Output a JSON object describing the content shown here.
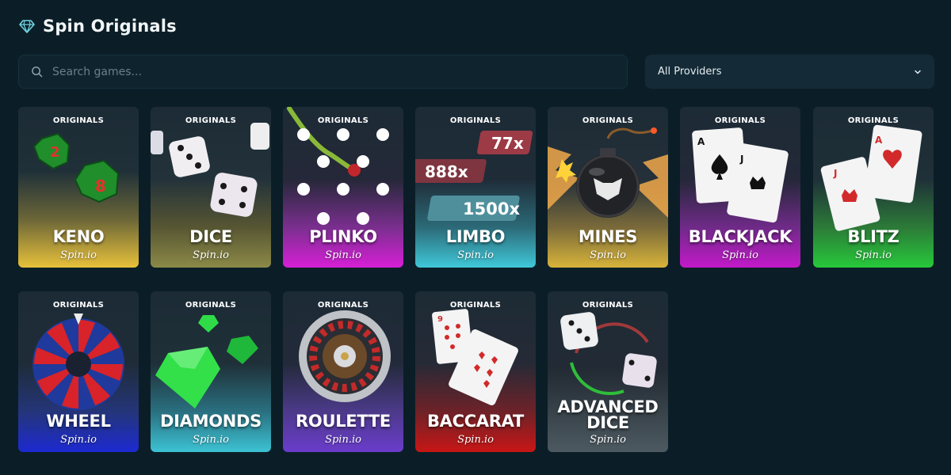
{
  "header": {
    "title": "Spin Originals",
    "icon": "diamond-icon"
  },
  "search": {
    "placeholder": "Search games...",
    "value": ""
  },
  "providers": {
    "selected": "All Providers"
  },
  "games": [
    {
      "name": "KENO",
      "tag": "ORIGINALS",
      "brand": "Spin.io",
      "color": "#e8c13a"
    },
    {
      "name": "DICE",
      "tag": "ORIGINALS",
      "brand": "Spin.io",
      "color": "#8c8a47"
    },
    {
      "name": "PLINKO",
      "tag": "ORIGINALS",
      "brand": "Spin.io",
      "color": "#d61fd6"
    },
    {
      "name": "LIMBO",
      "tag": "ORIGINALS",
      "brand": "Spin.io",
      "color": "#3fc8d8"
    },
    {
      "name": "MINES",
      "tag": "ORIGINALS",
      "brand": "Spin.io",
      "color": "#d8b43a"
    },
    {
      "name": "BLACKJACK",
      "tag": "ORIGINALS",
      "brand": "Spin.io",
      "color": "#c319c9"
    },
    {
      "name": "BLITZ",
      "tag": "ORIGINALS",
      "brand": "Spin.io",
      "color": "#27c93a"
    },
    {
      "name": "WHEEL",
      "tag": "ORIGINALS",
      "brand": "Spin.io",
      "color": "#1d2ad1"
    },
    {
      "name": "DIAMONDS",
      "tag": "ORIGINALS",
      "brand": "Spin.io",
      "color": "#3cc3d4"
    },
    {
      "name": "ROULETTE",
      "tag": "ORIGINALS",
      "brand": "Spin.io",
      "color": "#6a3ccb"
    },
    {
      "name": "BACCARAT",
      "tag": "ORIGINALS",
      "brand": "Spin.io",
      "color": "#c81616"
    },
    {
      "name": "ADVANCED DICE",
      "tag": "ORIGINALS",
      "brand": "Spin.io",
      "color": "#4d5a61"
    }
  ],
  "limbo_multipliers": [
    "77x",
    "888x",
    "1500x"
  ]
}
